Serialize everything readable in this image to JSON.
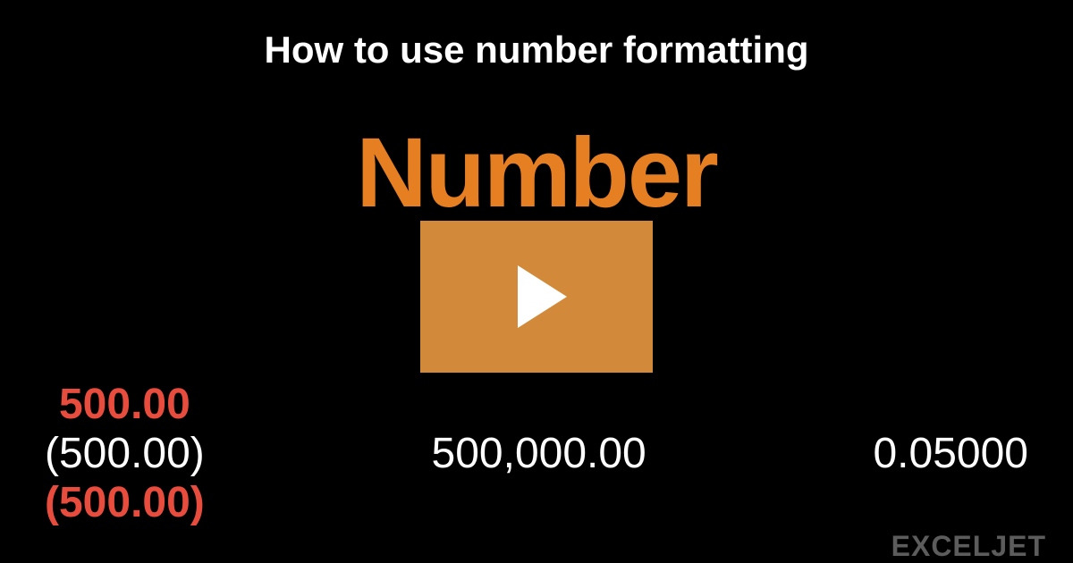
{
  "title": "How to use number formatting",
  "main_word": "Number",
  "numbers": {
    "left": {
      "red_bold": "500.00",
      "white_paren": "(500.00)",
      "red_paren": "(500.00)"
    },
    "center": "500,000.00",
    "right": "0.05000"
  },
  "watermark": "EXCELJET"
}
